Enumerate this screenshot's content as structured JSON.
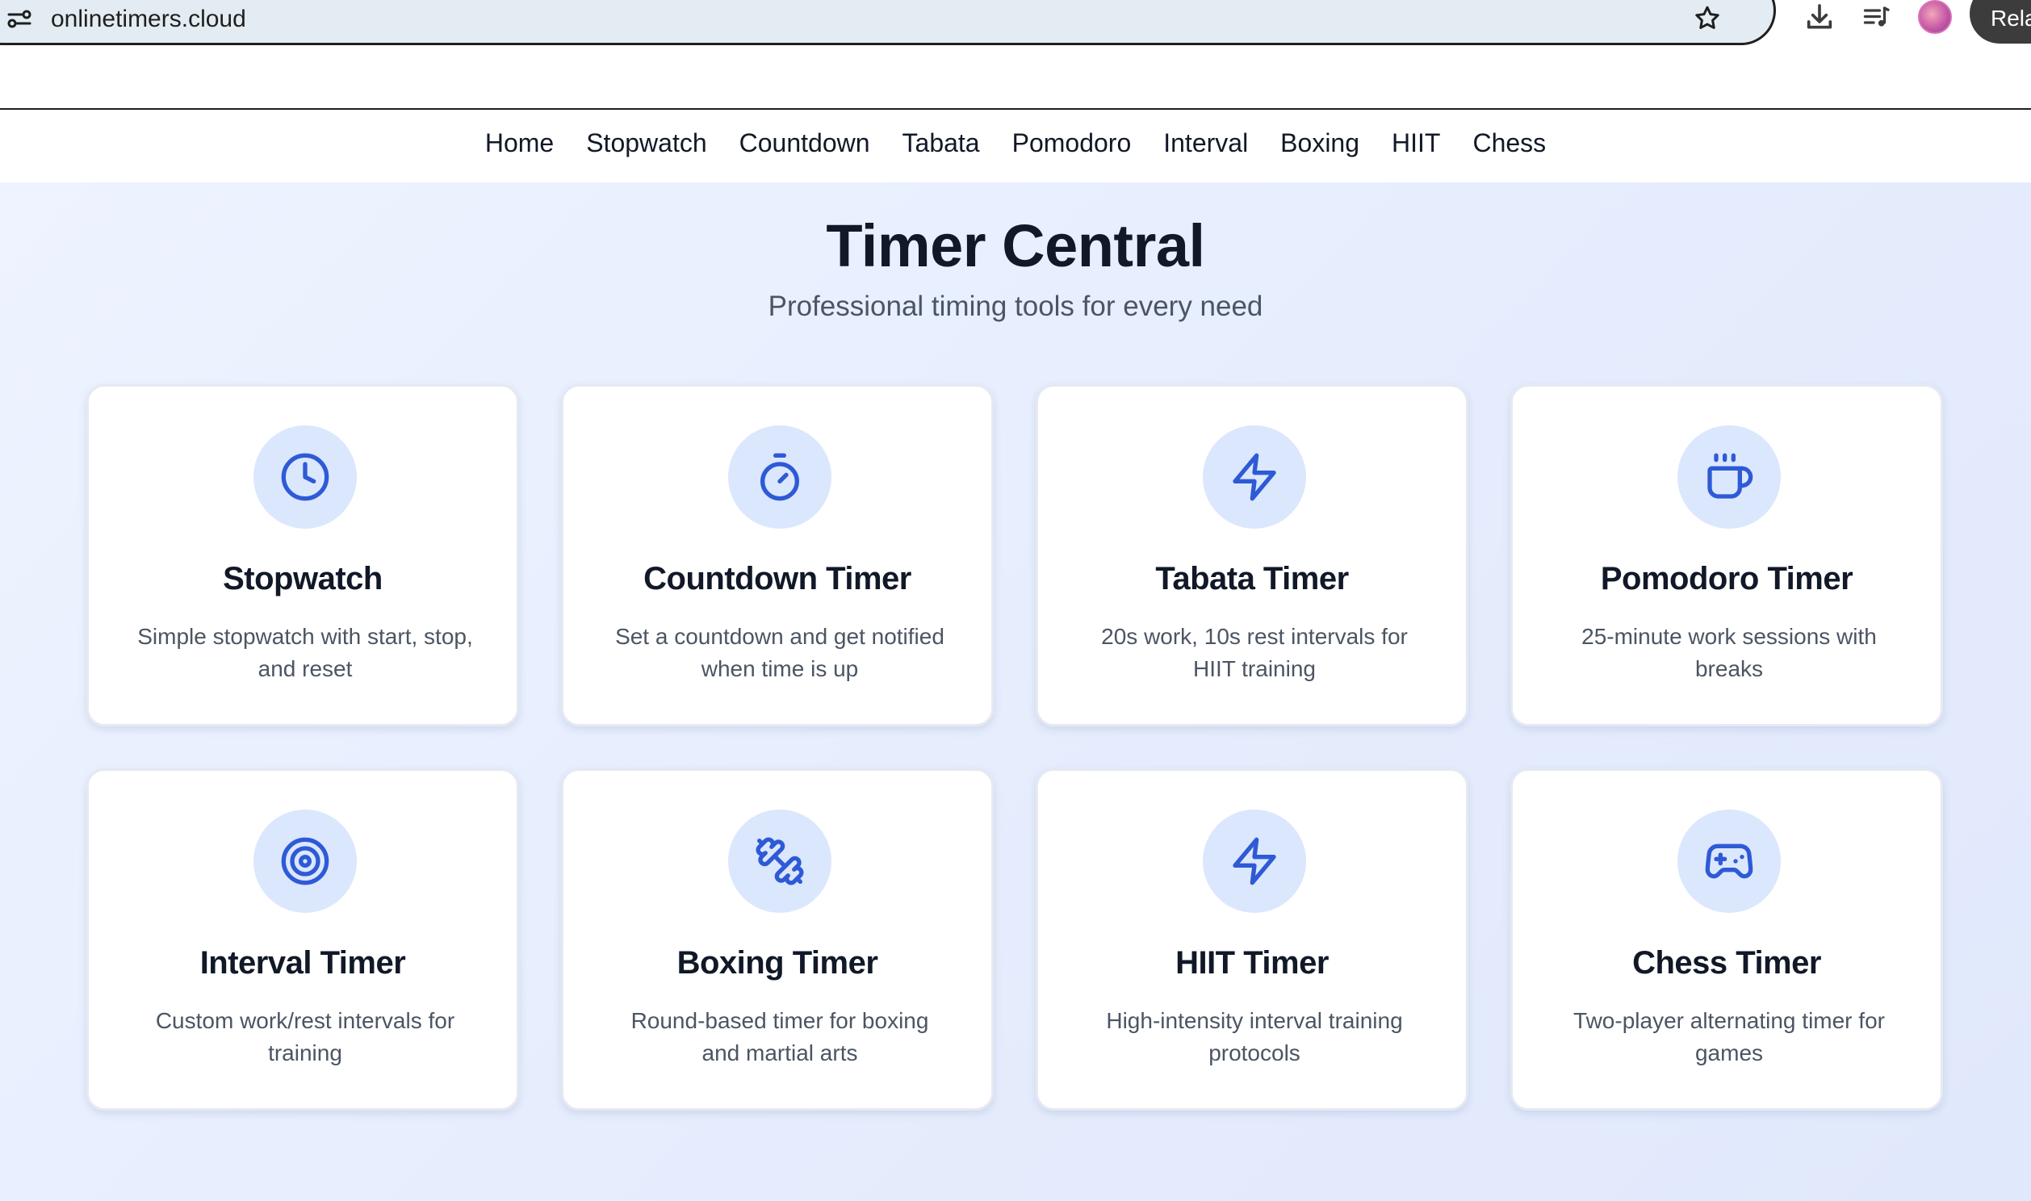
{
  "browser": {
    "url": "onlinetimers.cloud",
    "relaunch_label": "Rela",
    "icons": [
      "site-info-icon",
      "star-icon",
      "download-icon",
      "queue-icon",
      "avatar"
    ]
  },
  "nav": {
    "links": [
      "Home",
      "Stopwatch",
      "Countdown",
      "Tabata",
      "Pomodoro",
      "Interval",
      "Boxing",
      "HIIT",
      "Chess"
    ]
  },
  "hero": {
    "title": "Timer Central",
    "subtitle": "Professional timing tools for every need"
  },
  "accent_color": "#2f5ad6",
  "icon_bg_color": "#dbe7fd",
  "cards": [
    {
      "icon": "clock-icon",
      "title": "Stopwatch",
      "desc": "Simple stopwatch with start, stop, and reset"
    },
    {
      "icon": "timer-icon",
      "title": "Countdown Timer",
      "desc": "Set a countdown and get notified when time is up"
    },
    {
      "icon": "lightning-icon",
      "title": "Tabata Timer",
      "desc": "20s work, 10s rest intervals for HIIT training"
    },
    {
      "icon": "coffee-icon",
      "title": "Pomodoro Timer",
      "desc": "25-minute work sessions with breaks"
    },
    {
      "icon": "target-icon",
      "title": "Interval Timer",
      "desc": "Custom work/rest intervals for training"
    },
    {
      "icon": "dumbbell-icon",
      "title": "Boxing Timer",
      "desc": "Round-based timer for boxing and martial arts"
    },
    {
      "icon": "lightning-icon",
      "title": "HIIT Timer",
      "desc": "High-intensity interval training protocols"
    },
    {
      "icon": "gamepad-icon",
      "title": "Chess Timer",
      "desc": "Two-player alternating timer for games"
    }
  ]
}
